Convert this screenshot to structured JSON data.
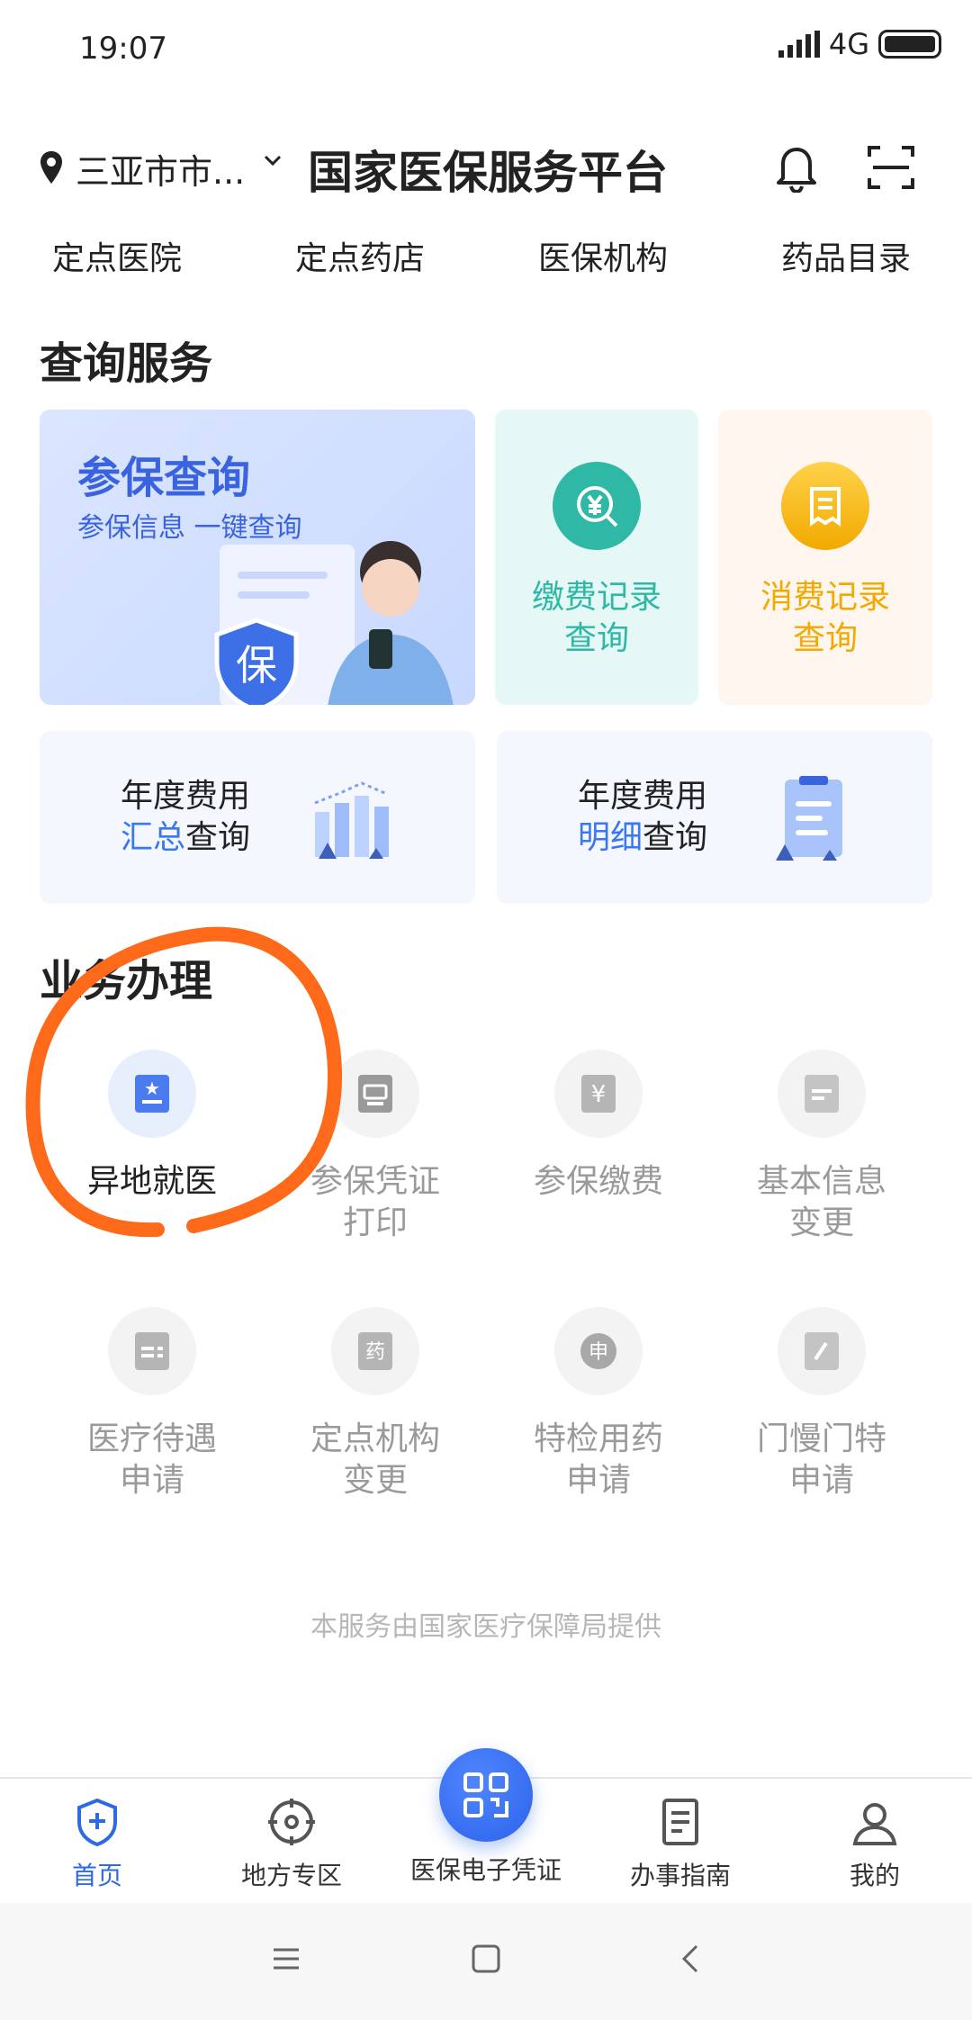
{
  "status_bar": {
    "time": "19:07",
    "network": "4G"
  },
  "header": {
    "location": "三亚市市...",
    "title": "国家医保服务平台"
  },
  "top_nav": [
    "定点医院",
    "定点药店",
    "医保机构",
    "药品目录"
  ],
  "query_section": {
    "title": "查询服务",
    "main_card": {
      "title": "参保查询",
      "subtitle": "参保信息 一键查询",
      "badge": "保"
    },
    "pay_card": {
      "line1": "缴费记录",
      "line2": "查询"
    },
    "spend_card": {
      "line1": "消费记录",
      "line2": "查询"
    },
    "annual_summary": {
      "line1": "年度费用",
      "highlight": "汇总",
      "rest": "查询"
    },
    "annual_detail": {
      "line1": "年度费用",
      "highlight": "明细",
      "rest": "查询"
    }
  },
  "business_section": {
    "title": "业务办理",
    "items": [
      {
        "line1": "异地就医",
        "line2": "",
        "glyph": "★"
      },
      {
        "line1": "参保凭证",
        "line2": "打印",
        "glyph": "▤"
      },
      {
        "line1": "参保缴费",
        "line2": "",
        "glyph": "¥"
      },
      {
        "line1": "基本信息",
        "line2": "变更",
        "glyph": "≡"
      },
      {
        "line1": "医疗待遇",
        "line2": "申请",
        "glyph": "≡"
      },
      {
        "line1": "定点机构",
        "line2": "变更",
        "glyph": "药"
      },
      {
        "line1": "特检用药",
        "line2": "申请",
        "glyph": "申"
      },
      {
        "line1": "门慢门特",
        "line2": "申请",
        "glyph": "/"
      }
    ]
  },
  "footer_note": "本服务由国家医疗保障局提供",
  "tab_bar": [
    {
      "label": "首页",
      "icon": "home-shield-icon"
    },
    {
      "label": "地方专区",
      "icon": "target-icon"
    },
    {
      "label": "医保电子凭证",
      "icon": "qr-code-icon"
    },
    {
      "label": "办事指南",
      "icon": "document-icon"
    },
    {
      "label": "我的",
      "icon": "user-icon"
    }
  ],
  "colors": {
    "accent": "#2f6ae6",
    "annotation": "#ff6a1a",
    "pay_green": "#2fb8a6",
    "spend_orange": "#f2a900"
  }
}
